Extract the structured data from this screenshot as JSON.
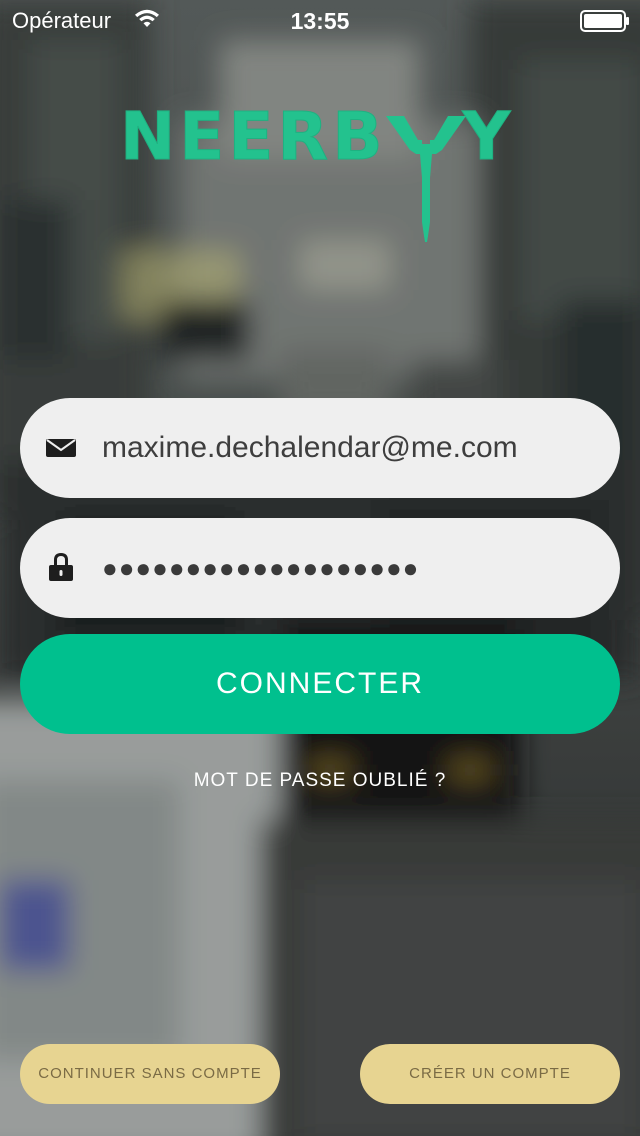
{
  "status_bar": {
    "carrier": "Opérateur",
    "time": "13:55"
  },
  "logo": {
    "text": "NEERBY",
    "icon": "eiffel-tower-icon",
    "color": "#23c28e"
  },
  "login": {
    "email": {
      "icon": "mail-icon",
      "value": "maxime.dechalendar@me.com"
    },
    "password": {
      "icon": "lock-icon",
      "value": "●●●●●●●●●●●●●●●●●●●"
    },
    "connect_label": "CONNECTER",
    "forgot_label": "MOT DE PASSE OUBLIÉ ?"
  },
  "footer": {
    "guest_label": "CONTINUER SANS COMPTE",
    "create_label": "CRÉER UN COMPTE"
  },
  "colors": {
    "accent": "#00c08e",
    "secondary_button": "#e7d491",
    "field_background": "#efefef"
  }
}
